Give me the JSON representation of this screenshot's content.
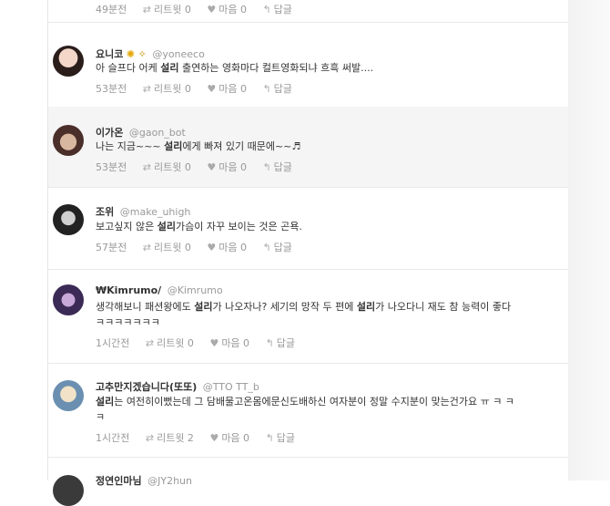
{
  "tweets": [
    {
      "time": "49분전",
      "text_parts": [],
      "retweet_label": "리트윗 0",
      "like_label": "마음 0",
      "reply_label": "답글"
    },
    {
      "name": "요니코",
      "handle": "@yoneeco",
      "time": "53분전",
      "text_parts": [
        "아 슬프다 어케 ",
        "설리",
        " 출연하는 영화마다 컬트영화되냐 흐흑 써발...."
      ],
      "retweet_label": "리트윗 0",
      "like_label": "마음 0",
      "reply_label": "답글"
    },
    {
      "name": "이가온",
      "handle": "@gaon_bot",
      "time": "53분전",
      "text_parts": [
        "나는 지금~~~ ",
        "설리",
        "에게 빠져 있기 때문에~~♬"
      ],
      "retweet_label": "리트윗 0",
      "like_label": "마음 0",
      "reply_label": "답글"
    },
    {
      "name": "조위",
      "handle": "@make_uhigh",
      "time": "57분전",
      "text_parts": [
        "보고싶지 않은 ",
        "설리",
        "가슴이 자꾸 보이는 것은 곤욕."
      ],
      "retweet_label": "리트윗 0",
      "like_label": "마음 0",
      "reply_label": "답글"
    },
    {
      "name": "₩Kimrumo/",
      "handle": "@Kimrumo",
      "time": "1시간전",
      "text_parts": [
        "생각해보니 패션왕에도 ",
        "설리",
        "가 나오자나? 세기의 망작 두 편에 ",
        "설리",
        "가 나오다니 재도 참 능력이 좋다"
      ],
      "text_line2": "ㅋㅋㅋㅋㅋㅋㅋ",
      "retweet_label": "리트윗 0",
      "like_label": "마음 0",
      "reply_label": "답글"
    },
    {
      "name": "고추만지겠습니다(또또)",
      "handle": "@TTO TT_b",
      "time": "1시간전",
      "text_parts": [
        "설리",
        "는 여전히이뻤는데 그 담배물고온몸에문신도배하신 여자분이 정말 수지분이 맞는건가요 ㅠ ㅋ ㅋ"
      ],
      "text_line2": "ㅋ",
      "retweet_label": "리트윗 2",
      "like_label": "마음 0",
      "reply_label": "답글"
    },
    {
      "name": "정연인마님",
      "handle": "@JY2hun"
    }
  ]
}
